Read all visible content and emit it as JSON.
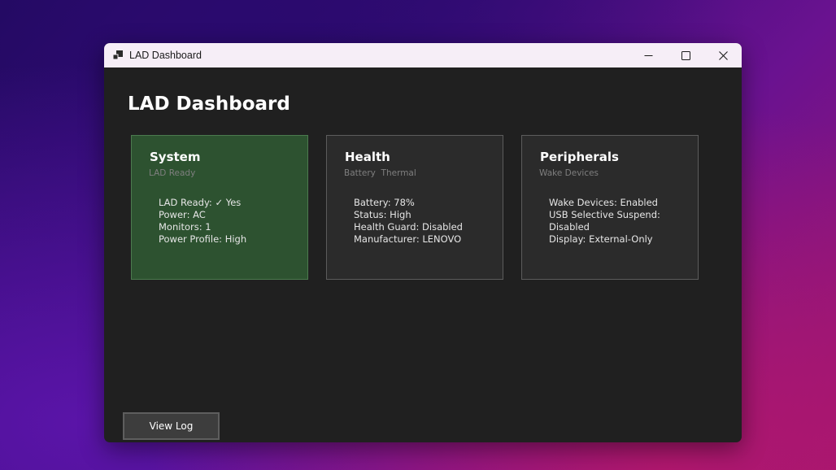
{
  "window": {
    "title": "LAD Dashboard"
  },
  "header": {
    "title": "LAD Dashboard"
  },
  "cards": [
    {
      "title": "System",
      "subtitle": "LAD Ready",
      "lines": [
        "LAD Ready: ✓ Yes",
        "Power: AC",
        "Monitors: 1",
        "Power Profile: High"
      ]
    },
    {
      "title": "Health",
      "subtitle": "Battery  Thermal",
      "lines": [
        "Battery: 78%",
        "Status: High",
        "Health Guard: Disabled",
        "Manufacturer: LENOVO"
      ]
    },
    {
      "title": "Peripherals",
      "subtitle": "Wake Devices",
      "lines": [
        "Wake Devices: Enabled",
        "USB Selective Suspend:",
        "Disabled",
        "Display: External-Only"
      ]
    }
  ],
  "footer": {
    "view_log_label": "View Log"
  },
  "colors": {
    "system_card_bg": "#2d5230",
    "card_bg": "#2b2b2b",
    "window_bg": "#202020"
  }
}
